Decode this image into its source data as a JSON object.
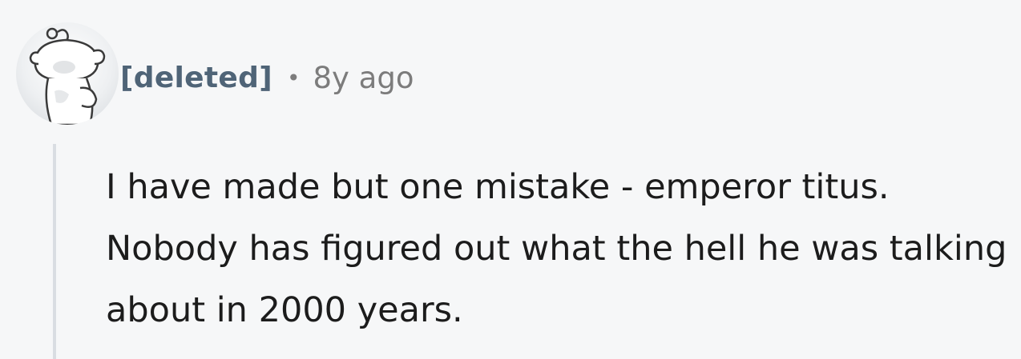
{
  "comment": {
    "author": "[deleted]",
    "separator": "•",
    "timestamp": "8y ago",
    "body": "I have made but one mistake - emperor titus. Nobody has figured out what the hell he was talking about in 2000 years."
  },
  "avatar": {
    "icon": "reddit-snoo-deleted-icon"
  }
}
